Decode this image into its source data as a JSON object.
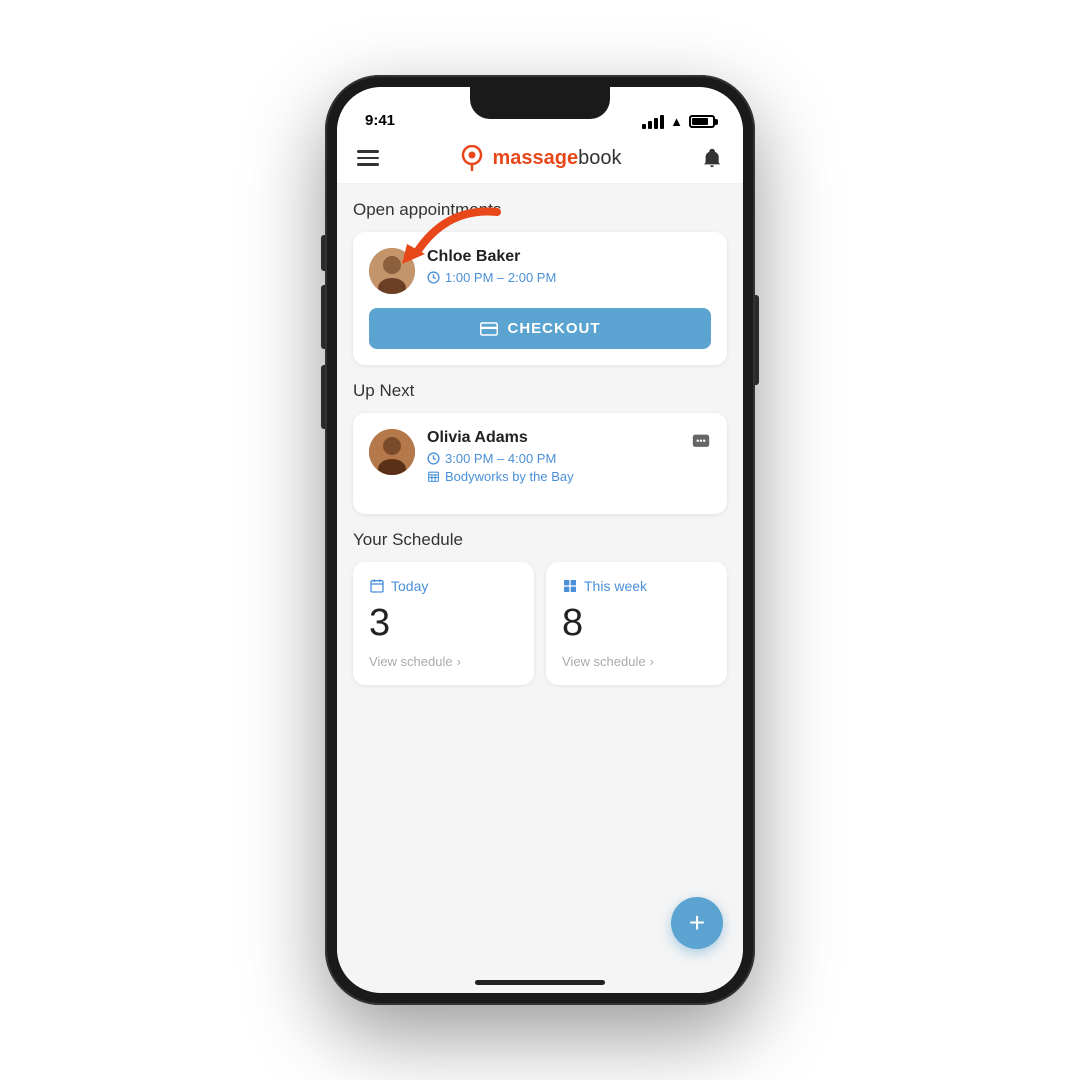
{
  "statusBar": {
    "time": "9:41"
  },
  "header": {
    "logoText": "massagebook",
    "logoHighlight": "massage"
  },
  "openAppointments": {
    "sectionTitle": "Open appointments",
    "client": {
      "name": "Chloe Baker",
      "time": "1:00 PM – 2:00 PM"
    },
    "checkoutButton": "CHECKOUT"
  },
  "upNext": {
    "sectionTitle": "Up Next",
    "client": {
      "name": "Olivia Adams",
      "time": "3:00 PM – 4:00 PM",
      "location": "Bodyworks by the Bay"
    }
  },
  "schedule": {
    "sectionTitle": "Your Schedule",
    "today": {
      "label": "Today",
      "count": "3",
      "link": "View schedule"
    },
    "thisWeek": {
      "label": "This week",
      "count": "8",
      "link": "View schedule"
    }
  },
  "fab": {
    "label": "+"
  }
}
